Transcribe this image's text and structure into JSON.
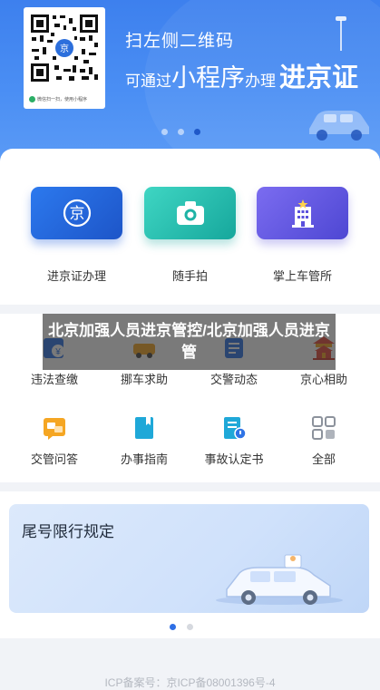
{
  "banner": {
    "line1": "扫左侧二维码",
    "line2_prefix": "可通过",
    "line2_big": "小程序",
    "line2_suffix": "办理",
    "line2_brand": "进京证",
    "qr_caption": "微信扫一扫，使用小程序",
    "page_dots": 3,
    "active_dot": 2
  },
  "primary_services": [
    {
      "label": "进京证办理",
      "icon": "jing-seal-icon"
    },
    {
      "label": "随手拍",
      "icon": "camera-icon"
    },
    {
      "label": "掌上车管所",
      "icon": "building-icon"
    }
  ],
  "grid_services": [
    {
      "label": "违法查缴",
      "icon": "fine-payment-icon"
    },
    {
      "label": "挪车求助",
      "icon": "move-car-icon"
    },
    {
      "label": "交警动态",
      "icon": "news-icon"
    },
    {
      "label": "京心相助",
      "icon": "temple-icon"
    },
    {
      "label": "交管问答",
      "icon": "qa-icon"
    },
    {
      "label": "办事指南",
      "icon": "guide-book-icon"
    },
    {
      "label": "事故认定书",
      "icon": "accident-document-icon"
    },
    {
      "label": "全部",
      "icon": "grid-all-icon"
    }
  ],
  "overlay_caption": "北京加强人员进京管控/北京加强人员进京管",
  "promo": {
    "title": "尾号限行规定",
    "page_dots": 2,
    "active_dot": 0
  },
  "footer": "ICP备案号：京ICP备08001396号-4",
  "colors": {
    "banner_blue": "#3d80ee",
    "tile_blue": "#2c79ee",
    "tile_teal": "#16a79c",
    "tile_purple": "#5e52de",
    "accent_orange": "#f5a623",
    "accent_red": "#e54b3c"
  }
}
